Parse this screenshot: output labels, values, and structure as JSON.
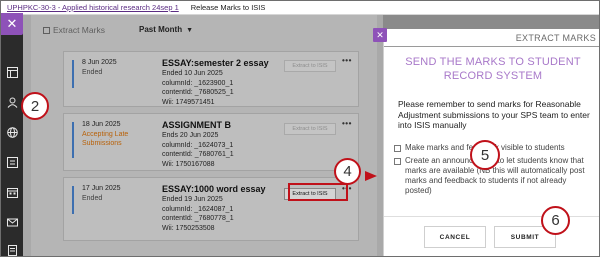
{
  "breadcrumb": {
    "course_link": "UPHPKC-30-3 - Applied historical research 24sep 1",
    "current_page": "Release Marks to ISIS"
  },
  "left_panel": {
    "title": "Extract Marks",
    "filter_value": "Past Month",
    "isis_button_label": "Extract to ISIS",
    "cards": [
      {
        "date": "8 Jun 2025",
        "status": "Ended",
        "status_type": "ended",
        "title": "ESSAY:semester 2 essay",
        "meta": [
          "Ended 10 Jun 2025",
          "columnId: _1623900_1",
          "contentId: _7680525_1",
          "Wii: 1749571451"
        ],
        "isis_active": false
      },
      {
        "date": "18 Jun 2025",
        "status": "Accepting Late Submissions",
        "status_type": "late",
        "title": "ASSIGNMENT B",
        "meta": [
          "Ends 20 Jun 2025",
          "columnId: _1624073_1",
          "contentId: _7680761_1",
          "Wii: 1750167088"
        ],
        "isis_active": false
      },
      {
        "date": "17 Jun 2025",
        "status": "Ended",
        "status_type": "ended",
        "title": "ESSAY:1000 word essay",
        "meta": [
          "Ended 19 Jun 2025",
          "columnId: _1624087_1",
          "contentId: _7680778_1",
          "Wii: 1750253508"
        ],
        "isis_active": true
      }
    ]
  },
  "right_panel": {
    "header": "EXTRACT MARKS",
    "heading": "SEND THE MARKS TO STUDENT RECORD SYSTEM",
    "description": "Please remember to send marks for Reasonable Adjustment submissions to your SPS team to enter into ISIS manually",
    "checkbox_1": "Make marks and feedback visible to students",
    "checkbox_2": "Create an announcement to let students know that marks are available (NB this will automatically post marks and feedback to students if not already posted)",
    "cancel_label": "CANCEL",
    "submit_label": "SUBMIT"
  },
  "callouts": {
    "two": "2",
    "four": "4",
    "five": "5",
    "six": "6"
  },
  "colors": {
    "accent_purple": "#8e52b8",
    "heading_purple": "#a878c9",
    "callout_red": "#c0111a",
    "late_orange": "#b8620a",
    "card_accent_blue": "#3d6fb0"
  }
}
